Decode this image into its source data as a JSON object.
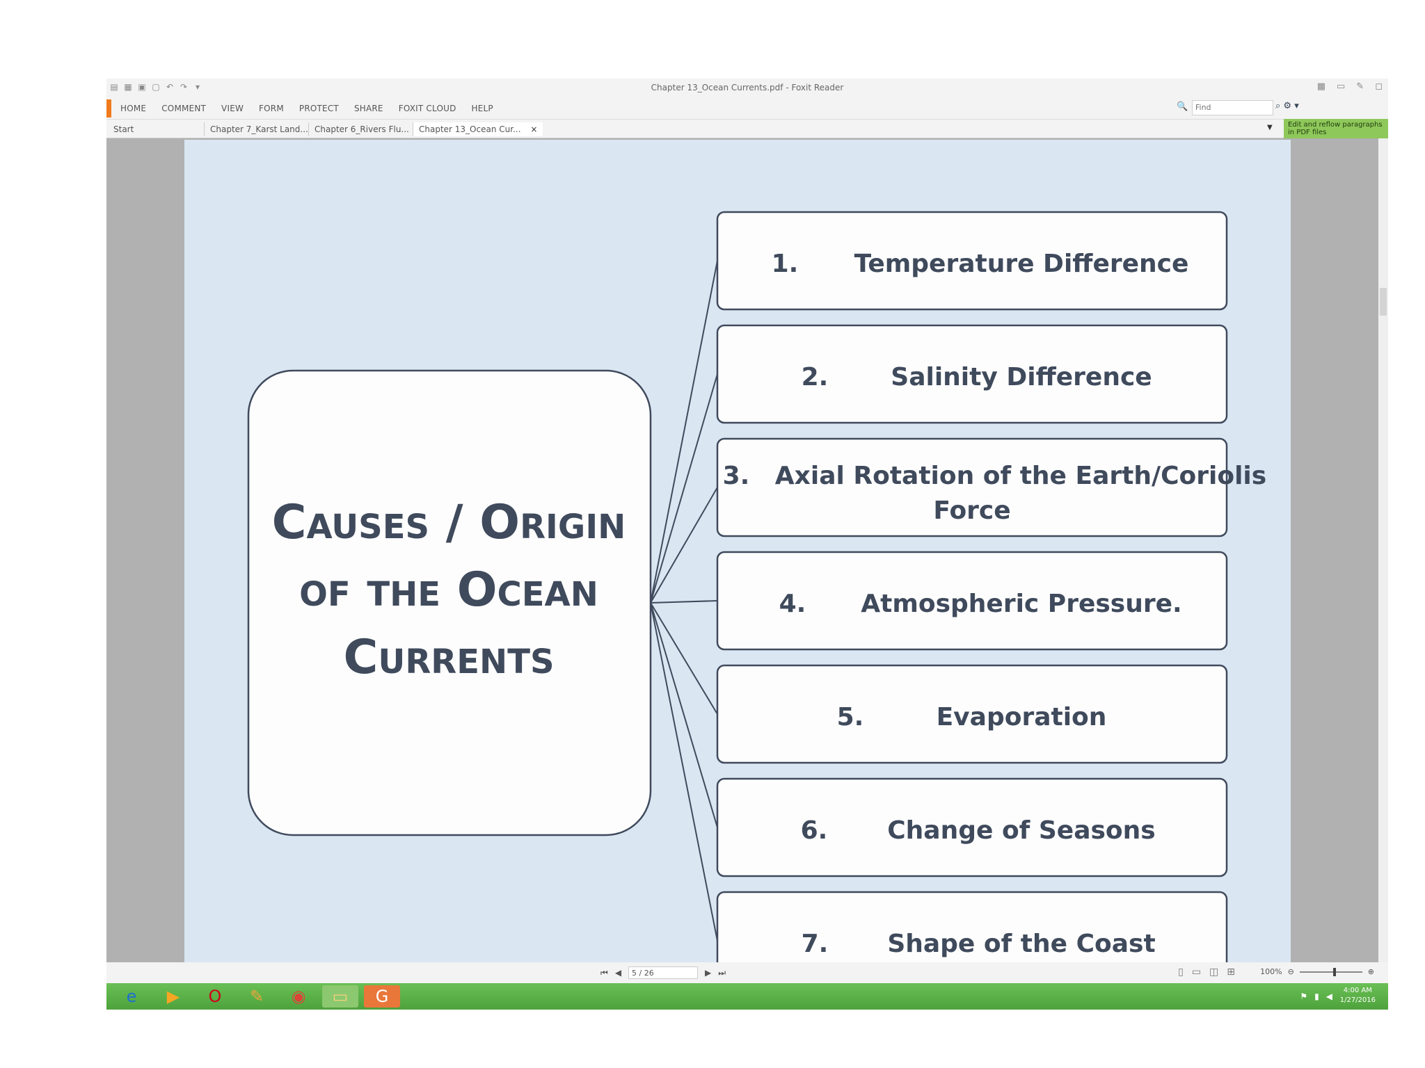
{
  "app": {
    "title": "Chapter 13_Ocean Currents.pdf - Foxit Reader",
    "menu": [
      "HOME",
      "COMMENT",
      "VIEW",
      "FORM",
      "PROTECT",
      "SHARE",
      "FOXIT CLOUD",
      "HELP"
    ],
    "search_placeholder": "Find",
    "tip_text": "Edit and reflow paragraphs in PDF files"
  },
  "tabs": {
    "start": "Start",
    "items": [
      "Chapter 7_Karst Land...",
      "Chapter 6_Rivers Flu...",
      "Chapter 13_Ocean Cur..."
    ],
    "close": "×"
  },
  "status": {
    "page_indicator": "5 / 26",
    "zoom": "100%"
  },
  "clock": {
    "time": "4:00 AM",
    "date": "1/27/2016"
  },
  "diagram": {
    "center_line1": "Causes / Origin",
    "center_line2": "of the Ocean",
    "center_line3": "Currents",
    "items": [
      {
        "number": "1.",
        "label": "Temperature Difference"
      },
      {
        "number": "2.",
        "label": "Salinity Difference"
      },
      {
        "number": "3.",
        "label": "Axial Rotation of the Earth/Coriolis",
        "label2": "Force"
      },
      {
        "number": "4.",
        "label": "Atmospheric Pressure."
      },
      {
        "number": "5.",
        "label": "Evaporation"
      },
      {
        "number": "6.",
        "label": "Change of Seasons"
      },
      {
        "number": "7.",
        "label": "Shape of the Coast"
      }
    ]
  },
  "colors": {
    "text": "#3f4a5c",
    "page_bg": "#dae6f2",
    "accent": "#f07b1c",
    "taskbar": "#5cb147"
  }
}
